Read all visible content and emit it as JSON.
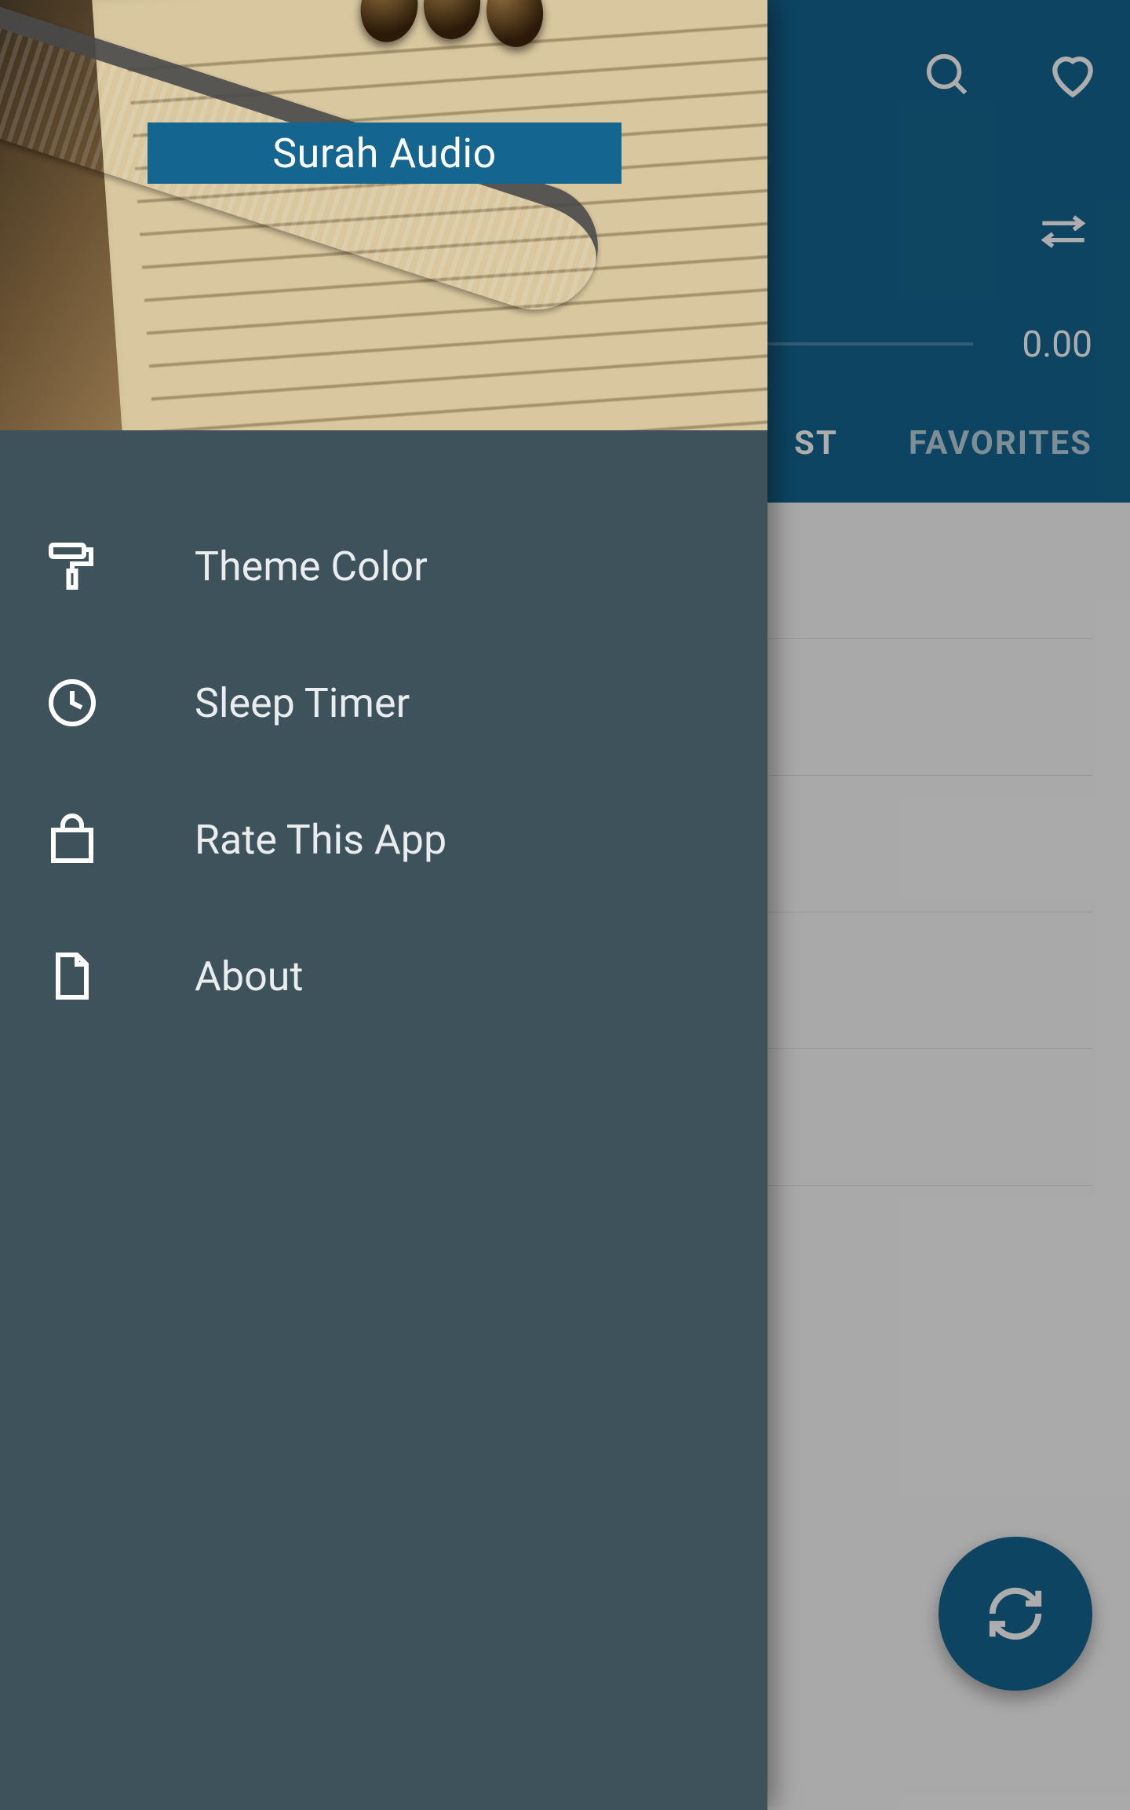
{
  "drawer": {
    "title": "Surah Audio",
    "items": [
      {
        "label": "Theme Color",
        "icon": "paint-roller-icon"
      },
      {
        "label": "Sleep Timer",
        "icon": "clock-icon"
      },
      {
        "label": "Rate This App",
        "icon": "shopping-bag-icon"
      },
      {
        "label": "About",
        "icon": "document-icon"
      }
    ]
  },
  "player": {
    "time": "0.00"
  },
  "tabs": {
    "playlist_fragment": "ST",
    "favorites": "FAVORITES"
  }
}
